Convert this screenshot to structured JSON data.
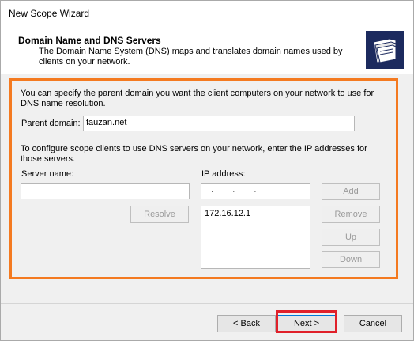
{
  "window": {
    "title": "New Scope Wizard"
  },
  "header": {
    "title": "Domain Name and DNS Servers",
    "description": "The Domain Name System (DNS) maps and translates domain names used by clients on your network."
  },
  "content": {
    "intro": "You can specify the parent domain you want the client computers on your network to use for DNS name resolution.",
    "parent_domain_label": "Parent domain:",
    "parent_domain_value": "fauzan.net",
    "dns_instruction": "To configure scope clients to use DNS servers on your network, enter the IP addresses for those servers.",
    "server_name_label": "Server name:",
    "server_name_value": "",
    "ip_address_label": "IP address:",
    "ip_address_value": " .  .  . ",
    "ip_list": [
      "172.16.12.1"
    ],
    "buttons": {
      "resolve": "Resolve",
      "add": "Add",
      "remove": "Remove",
      "up": "Up",
      "down": "Down"
    }
  },
  "footer": {
    "back": "< Back",
    "next": "Next >",
    "cancel": "Cancel"
  },
  "colors": {
    "highlight_orange": "#f47a20",
    "highlight_red": "#e0202a",
    "icon_bg": "#1c2a5e"
  }
}
